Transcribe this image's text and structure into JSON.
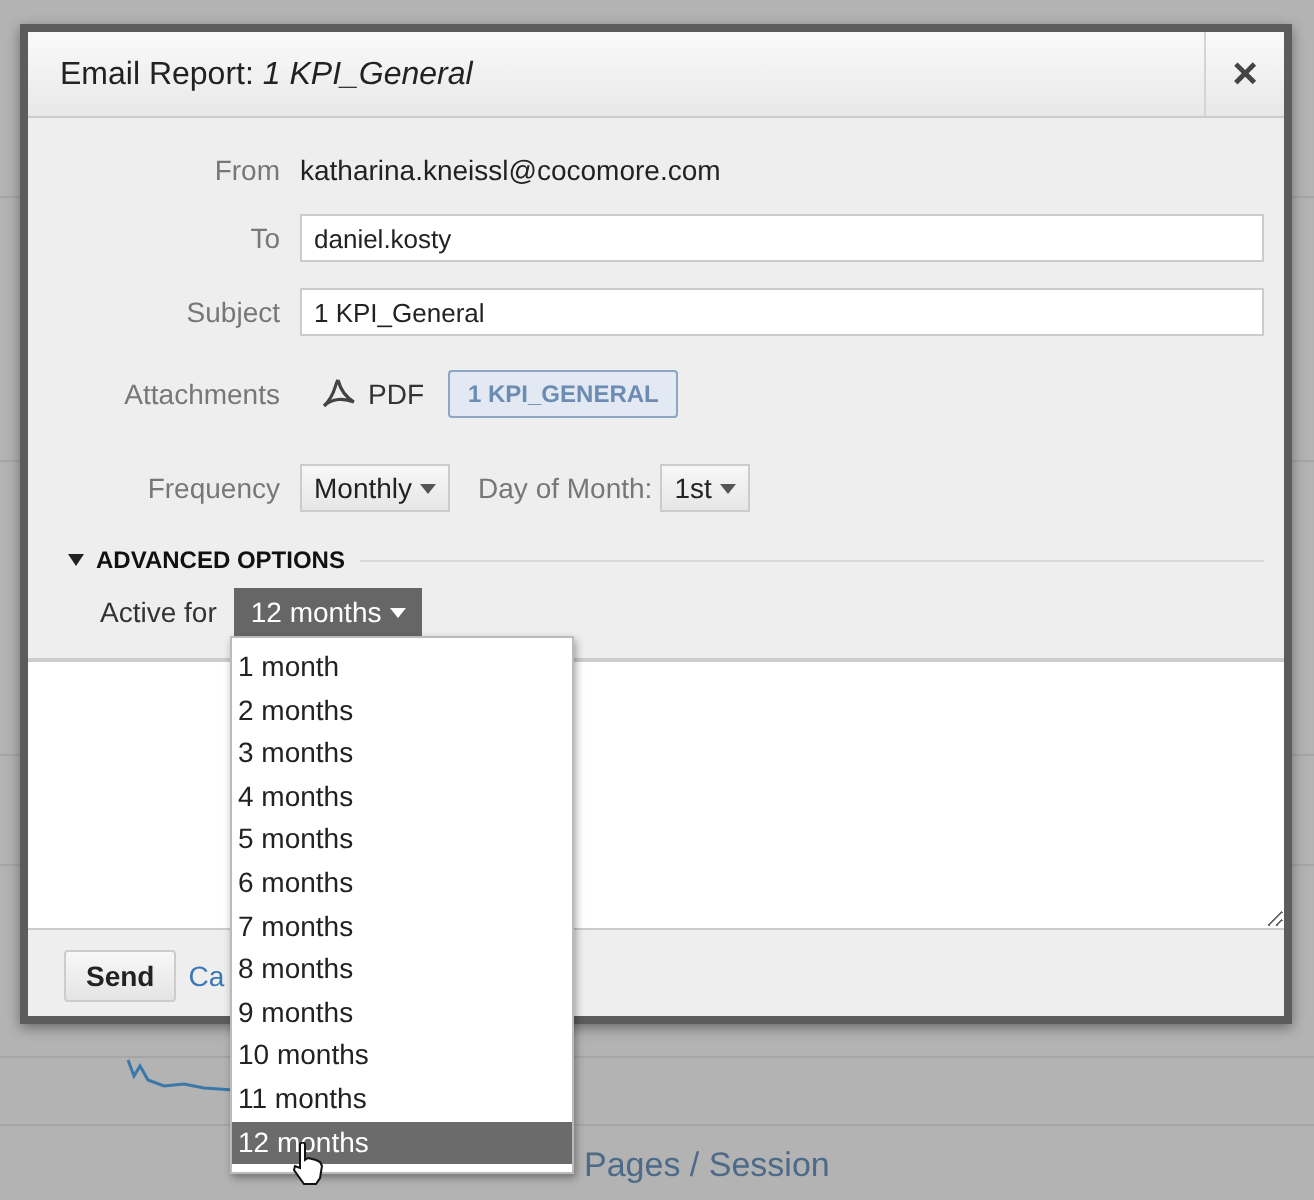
{
  "background": {
    "metric": "Pages / Session"
  },
  "dialog": {
    "title": "Email Report:",
    "report_name": "1 KPI_General",
    "close": "×",
    "from": {
      "label": "From",
      "value": "katharina.kneissl@cocomore.com"
    },
    "to": {
      "label": "To",
      "value": "daniel.kosty"
    },
    "subject": {
      "label": "Subject",
      "value": "1 KPI_General"
    },
    "attachments": {
      "label": "Attachments",
      "format": "PDF",
      "tag": "1 KPI_GENERAL"
    },
    "frequency": {
      "label": "Frequency",
      "value": "Monthly"
    },
    "day_of_month": {
      "label": "Day of Month:",
      "value": "1st"
    },
    "advanced": {
      "label": "ADVANCED OPTIONS",
      "expanded": true
    },
    "active_for": {
      "label": "Active for",
      "value": "12 months"
    },
    "buttons": {
      "send": "Send",
      "cancel": "Ca"
    }
  },
  "dropdown": {
    "items": [
      {
        "label": "1 month",
        "selected": false
      },
      {
        "label": "2 months",
        "selected": false
      },
      {
        "label": "3 months",
        "selected": false
      },
      {
        "label": "4 months",
        "selected": false
      },
      {
        "label": "5 months",
        "selected": false
      },
      {
        "label": "6 months",
        "selected": false
      },
      {
        "label": "7 months",
        "selected": false
      },
      {
        "label": "8 months",
        "selected": false
      },
      {
        "label": "9 months",
        "selected": false
      },
      {
        "label": "10 months",
        "selected": false
      },
      {
        "label": "11 months",
        "selected": false
      },
      {
        "label": "12 months",
        "selected": true
      }
    ]
  }
}
